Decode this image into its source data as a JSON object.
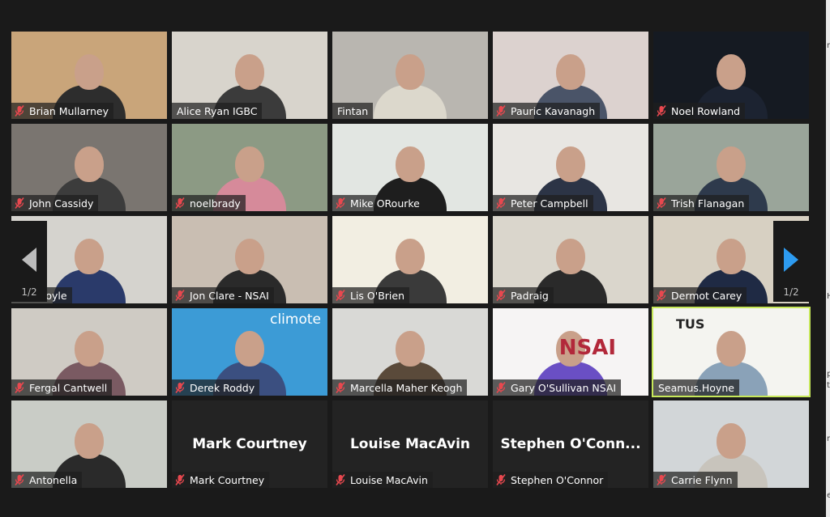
{
  "app": "Zoom Meeting - Gallery View",
  "pagination": {
    "current": "1/2",
    "prev_icon": "arrow-left-icon",
    "next_icon": "arrow-right-icon"
  },
  "colors": {
    "active_speaker_border": "#c7e85a",
    "mute_icon": "#e8484f",
    "next_arrow": "#2d9bf0",
    "background": "#1a1a1a"
  },
  "participants": [
    {
      "name": "Brian Mullarney",
      "muted": true,
      "video": true,
      "bg": "#c9a57a",
      "body": "#2d2d2d"
    },
    {
      "name": "Alice Ryan IGBC",
      "muted": false,
      "video": true,
      "bg": "#d8d4cc",
      "body": "#3b3b3b"
    },
    {
      "name": "Fintan",
      "muted": false,
      "video": true,
      "bg": "#b9b6b0",
      "body": "#dcd8cc"
    },
    {
      "name": "Pauric Kavanagh",
      "muted": true,
      "video": true,
      "bg": "#dcd2cf",
      "body": "#4a5468"
    },
    {
      "name": "Noel Rowland",
      "muted": true,
      "video": true,
      "bg": "#151a22",
      "body": "#1c2331"
    },
    {
      "name": "John Cassidy",
      "muted": true,
      "video": true,
      "bg": "#7a7570",
      "body": "#3c3c3c"
    },
    {
      "name": "noelbrady",
      "muted": true,
      "video": true,
      "bg": "#8c9a84",
      "body": "#d68a9a"
    },
    {
      "name": "Mike ORourke",
      "muted": true,
      "video": true,
      "bg": "#e2e6e2",
      "body": "#1e1e1e"
    },
    {
      "name": "Peter Campbell",
      "muted": true,
      "video": true,
      "bg": "#e8e6e2",
      "body": "#2c3446"
    },
    {
      "name": "Trish Flanagan",
      "muted": true,
      "video": true,
      "bg": "#9aa59a",
      "body": "#2e3a4c"
    },
    {
      "name": "a Coyle",
      "muted": true,
      "video": true,
      "bg": "#d5d3ce",
      "body": "#2a3a6a"
    },
    {
      "name": "Jon Clare - NSAI",
      "muted": true,
      "video": true,
      "bg": "#c9beb2",
      "body": "#2a2a2a"
    },
    {
      "name": "Lis O'Brien",
      "muted": true,
      "video": true,
      "bg": "#f2eee2",
      "body": "#3a3a3a"
    },
    {
      "name": "Padraig",
      "muted": true,
      "video": true,
      "bg": "#dad6cc",
      "body": "#2a2a2a"
    },
    {
      "name": "Dermot Carey",
      "muted": true,
      "video": true,
      "bg": "#d7d0c2",
      "body": "#1f2a44"
    },
    {
      "name": "Fergal Cantwell",
      "muted": true,
      "video": true,
      "bg": "#cfcbc4",
      "body": "#7a5a62"
    },
    {
      "name": "Derek Roddy",
      "muted": true,
      "video": true,
      "bg": "#3c9bd6",
      "body": "#3b4f80",
      "overlay": "climote"
    },
    {
      "name": "Marcella Maher Keogh",
      "muted": true,
      "video": true,
      "bg": "#d9d9d6",
      "body": "#5a4a3a"
    },
    {
      "name": "Gary O'Sullivan NSAI",
      "muted": true,
      "video": true,
      "bg": "#f6f4f4",
      "body": "#6a4fc4",
      "overlay": "NSAI"
    },
    {
      "name": "Seamus.Hoyne",
      "muted": false,
      "video": true,
      "active": true,
      "bg": "#f4f4f0",
      "body": "#8aa2b8",
      "overlay": "TUS"
    },
    {
      "name": "Antonella",
      "muted": true,
      "video": true,
      "bg": "#c9ccc6",
      "body": "#2a2a2a"
    },
    {
      "name": "Mark Courtney",
      "muted": true,
      "video": false,
      "display_name": "Mark Courtney"
    },
    {
      "name": "Louise MacAvin",
      "muted": true,
      "video": false,
      "display_name": "Louise MacAvin"
    },
    {
      "name": "Stephen O'Connor",
      "muted": true,
      "video": false,
      "display_name": "Stephen  O'Conn..."
    },
    {
      "name": "Carrie Flynn",
      "muted": true,
      "video": true,
      "bg": "#d2d6d8",
      "body": "#c8c4bc"
    }
  ],
  "page_edge_chars": [
    "r",
    "H",
    "p",
    "t",
    "r",
    "e"
  ]
}
